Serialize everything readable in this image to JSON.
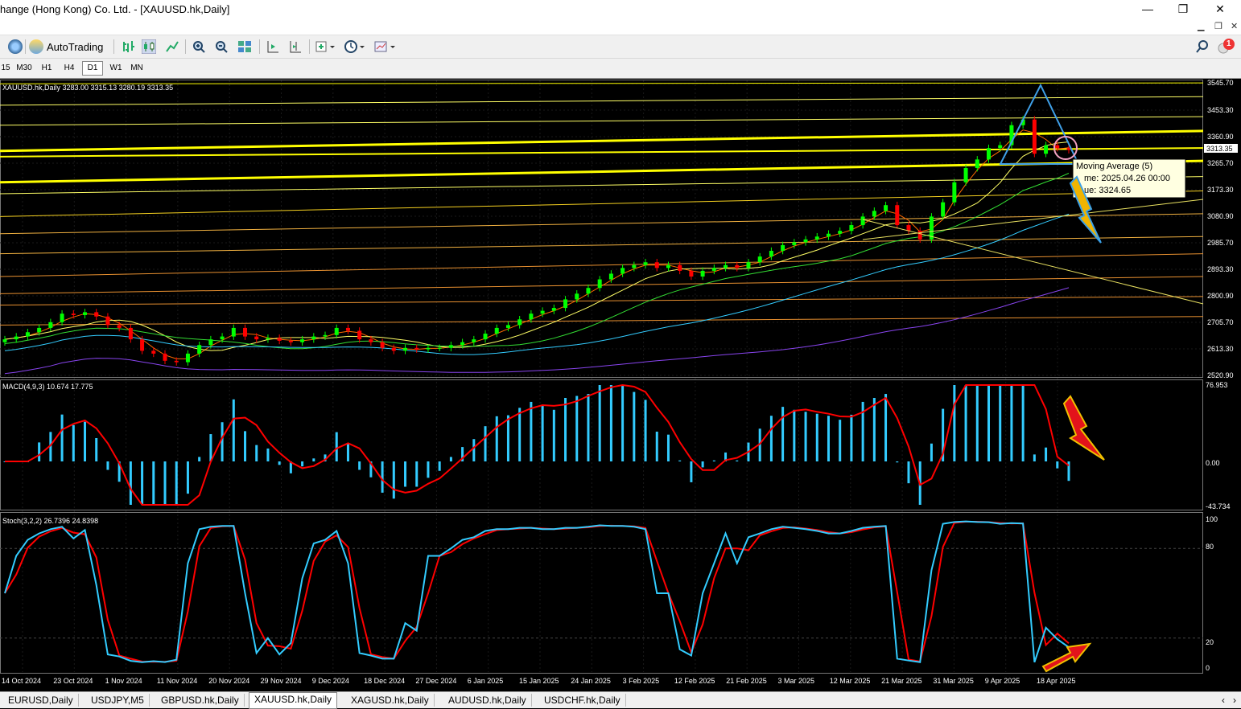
{
  "window": {
    "title": "hange (Hong Kong) Co. Ltd. - [XAUUSD.hk,Daily]",
    "minimize": "—",
    "maximize": "❐",
    "close": "✕"
  },
  "toolbar": {
    "autotrading_label": "AutoTrading",
    "notification_count": "1"
  },
  "timeframes": [
    "15",
    "M30",
    "H1",
    "H4",
    "D1",
    "W1",
    "MN"
  ],
  "active_timeframe": "D1",
  "main_panel": {
    "label": "XAUUSD.hk,Daily  3283.00 3315.13 3280.19 3313.35",
    "price_axis": [
      "3545.70",
      "3453.30",
      "3360.90",
      "3265.70",
      "3173.30",
      "3080.90",
      "2985.70",
      "2893.30",
      "2800.90",
      "2705.70",
      "2613.30",
      "2520.90"
    ],
    "current_price": "3313.35",
    "tooltip": {
      "line1": "Moving Average (5)",
      "line2": "me: 2025.04.26 00:00",
      "line3": "ue: 3324.65"
    }
  },
  "macd_panel": {
    "label": "MACD(4,9,3) 10.674 17.775",
    "axis": [
      "76.953",
      "0.00",
      "-43.734"
    ]
  },
  "stoch_panel": {
    "label": "Stoch(3,2,2) 26.7396 24.8398",
    "axis": [
      "100",
      "80",
      "20",
      "0"
    ]
  },
  "date_axis": [
    "14 Oct 2024",
    "23 Oct 2024",
    "1 Nov 2024",
    "11 Nov 2024",
    "20 Nov 2024",
    "29 Nov 2024",
    "9 Dec 2024",
    "18 Dec 2024",
    "27 Dec 2024",
    "6 Jan 2025",
    "15 Jan 2025",
    "24 Jan 2025",
    "3 Feb 2025",
    "12 Feb 2025",
    "21 Feb 2025",
    "3 Mar 2025",
    "12 Mar 2025",
    "21 Mar 2025",
    "31 Mar 2025",
    "9 Apr 2025",
    "18 Apr 2025"
  ],
  "tabs": [
    "EURUSD,Daily",
    "USDJPY,M5",
    "GBPUSD.hk,Daily",
    "XAUUSD.hk,Daily",
    "XAGUSD.hk,Daily",
    "AUDUSD.hk,Daily",
    "USDCHF.hk,Daily"
  ],
  "active_tab": "XAUUSD.hk,Daily",
  "colors": {
    "bull_candle": "#00ff00",
    "bear_candle": "#ff0000",
    "macd_hist": "#33ccff",
    "signal": "#ff0000",
    "stoch_main": "#33ccff",
    "stoch_signal": "#ff0000",
    "level_yellow": "#ffff00",
    "triangle": "#3fa0e8"
  },
  "chart_data": {
    "type": "line",
    "x_range": [
      "14 Oct 2024",
      "25 Apr 2025"
    ],
    "price_close": [
      2650,
      2660,
      2675,
      2690,
      2710,
      2740,
      2735,
      2745,
      2730,
      2700,
      2690,
      2650,
      2610,
      2600,
      2575,
      2570,
      2600,
      2630,
      2650,
      2660,
      2690,
      2660,
      2650,
      2655,
      2645,
      2640,
      2650,
      2660,
      2665,
      2690,
      2680,
      2650,
      2640,
      2620,
      2610,
      2620,
      2615,
      2620,
      2620,
      2630,
      2640,
      2650,
      2670,
      2690,
      2700,
      2720,
      2740,
      2750,
      2760,
      2790,
      2810,
      2830,
      2860,
      2880,
      2900,
      2910,
      2920,
      2900,
      2910,
      2890,
      2870,
      2890,
      2900,
      2910,
      2900,
      2920,
      2940,
      2960,
      2980,
      2990,
      3000,
      3010,
      3020,
      3030,
      3050,
      3080,
      3100,
      3120,
      3050,
      3030,
      3000,
      3080,
      3130,
      3200,
      3250,
      3280,
      3320,
      3330,
      3400,
      3420,
      3300,
      3330,
      3320,
      3313
    ],
    "macd_range": [
      -43.734,
      76.953
    ],
    "stoch_range": [
      0,
      100
    ],
    "price_range": [
      2520.9,
      3545.7
    ]
  }
}
